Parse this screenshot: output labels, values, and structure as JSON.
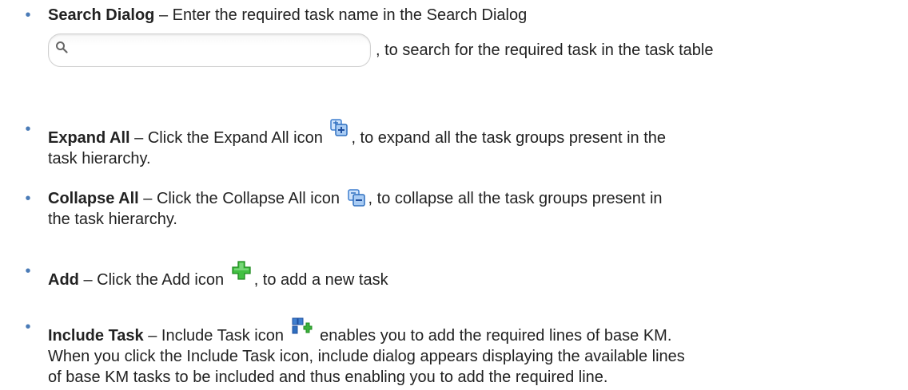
{
  "items": [
    {
      "term": "Search Dialog",
      "sep": " – ",
      "text_before": "Enter the required task name in the Search Dialog",
      "text_after": ", to search for the required task in the task table",
      "icon": "search-icon"
    },
    {
      "term": "Expand All",
      "sep": " – ",
      "text_before": "Click the Expand All icon",
      "text_after": ", to expand all the task groups present in the",
      "text_line2": "task hierarchy.",
      "icon": "expand-all-icon"
    },
    {
      "term": "Collapse All",
      "sep": " – ",
      "text_before": "Click the Collapse All icon",
      "text_after": ", to collapse all the task groups present in",
      "text_line2": "the task hierarchy.",
      "icon": "collapse-all-icon"
    },
    {
      "term": "Add",
      "sep": " – ",
      "text_before": "Click the Add icon",
      "text_after": ", to add a new task",
      "icon": "add-icon"
    },
    {
      "term": "Include Task",
      "sep": " – ",
      "text_before": "Include Task icon",
      "text_after": " enables you to add the required lines of base KM.",
      "text_line2": "When you click the Include Task icon, include dialog appears displaying the available lines",
      "text_line3": "of base KM tasks to be included and thus enabling you to add the required line.",
      "icon": "include-task-icon"
    }
  ],
  "colors": {
    "bullet": "#4a7bb7",
    "text": "#222222",
    "icon_blue": "#3f7fcf",
    "icon_green": "#3bb33b"
  }
}
